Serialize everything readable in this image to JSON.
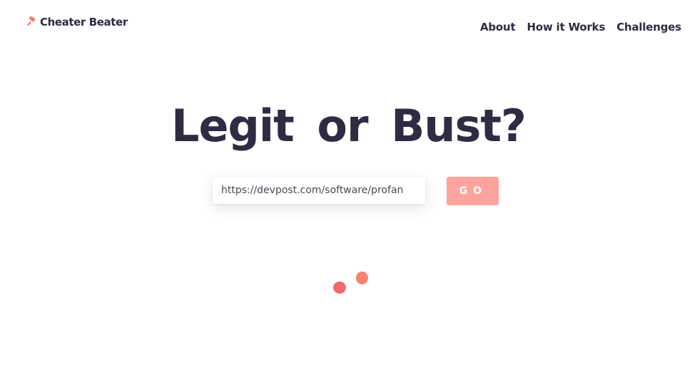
{
  "brand": {
    "name": "Cheater Beater",
    "icon": "gavel-icon",
    "accent_color": "#f27b68"
  },
  "nav": {
    "items": [
      {
        "label": "About"
      },
      {
        "label": "How it Works"
      },
      {
        "label": "Challenges"
      }
    ]
  },
  "hero": {
    "title": "Legit or Bust?"
  },
  "search": {
    "value": "https://devpost.com/software/profan",
    "button_label": "GO",
    "button_color": "#ffa39e"
  },
  "loader": {
    "dot_colors": [
      "#f06a6e",
      "#f5836f"
    ]
  }
}
